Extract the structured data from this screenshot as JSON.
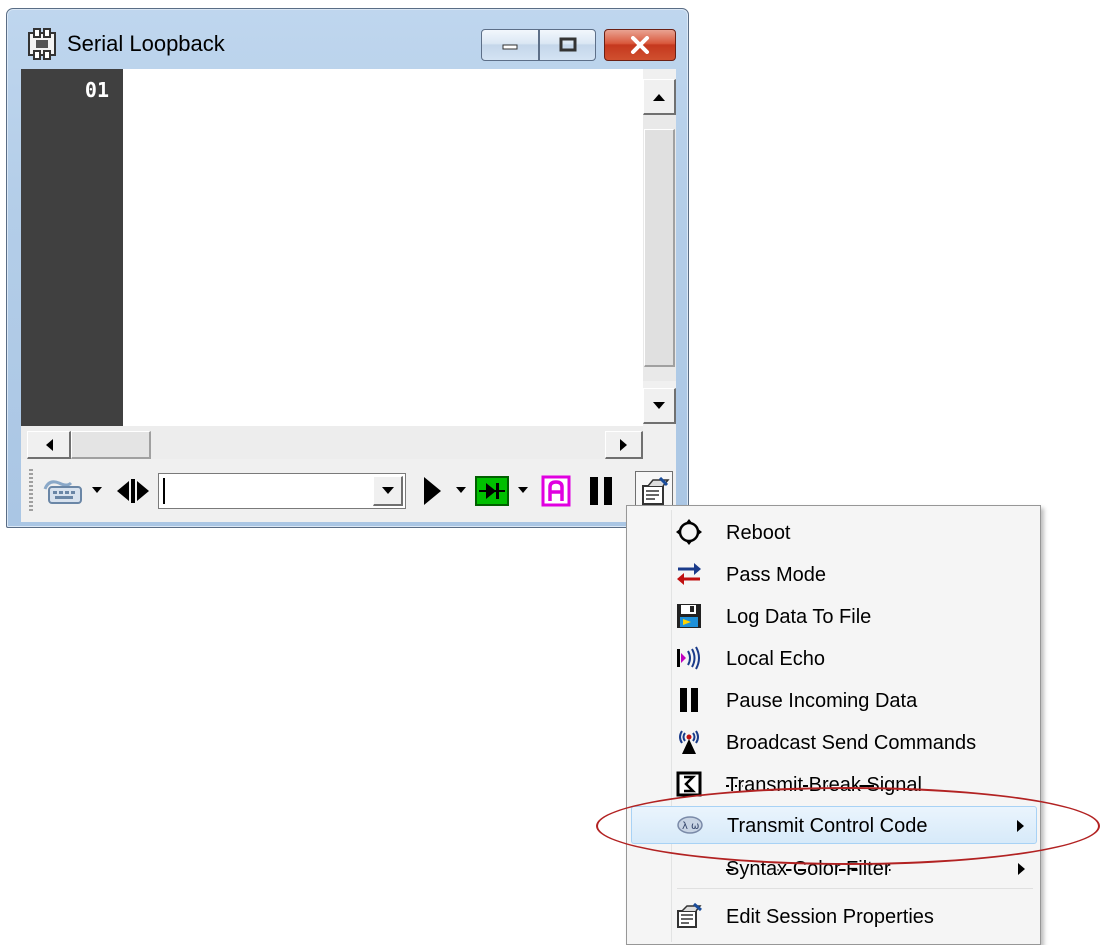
{
  "window": {
    "title": "Serial Loopback",
    "line_number": "01"
  },
  "toolbar": {
    "command_input_value": "",
    "icons": [
      "keyboard-icon",
      "split-cursor-icon",
      "send-play-icon",
      "loopback-diode-icon",
      "ascii-a-icon",
      "pause-icon",
      "edit-properties-icon"
    ]
  },
  "menu": {
    "items": [
      {
        "label": "Reboot",
        "icon": "reboot-icon"
      },
      {
        "label": "Pass Mode",
        "icon": "pass-mode-icon"
      },
      {
        "label": "Log Data To File",
        "icon": "save-log-icon"
      },
      {
        "label": "Local Echo",
        "icon": "local-echo-icon"
      },
      {
        "label": "Pause Incoming Data",
        "icon": "pause-icon"
      },
      {
        "label": "Broadcast Send Commands",
        "icon": "broadcast-icon"
      },
      {
        "label": "Transmit Break Signal",
        "icon": "break-signal-icon"
      },
      {
        "label": "Transmit Control Code",
        "icon": "control-code-icon",
        "has_submenu": true,
        "highlighted": true
      },
      {
        "label": "Syntax Color Filter",
        "icon": "",
        "has_submenu": true
      },
      {
        "label": "Edit Session Properties",
        "icon": "edit-properties-icon"
      }
    ]
  },
  "colors": {
    "gutter": "#404040",
    "highlight_bg": "#d7eaf9",
    "annotation": "#b22222",
    "loopback_green": "#00c000",
    "ascii_magenta": "#e000e0"
  }
}
